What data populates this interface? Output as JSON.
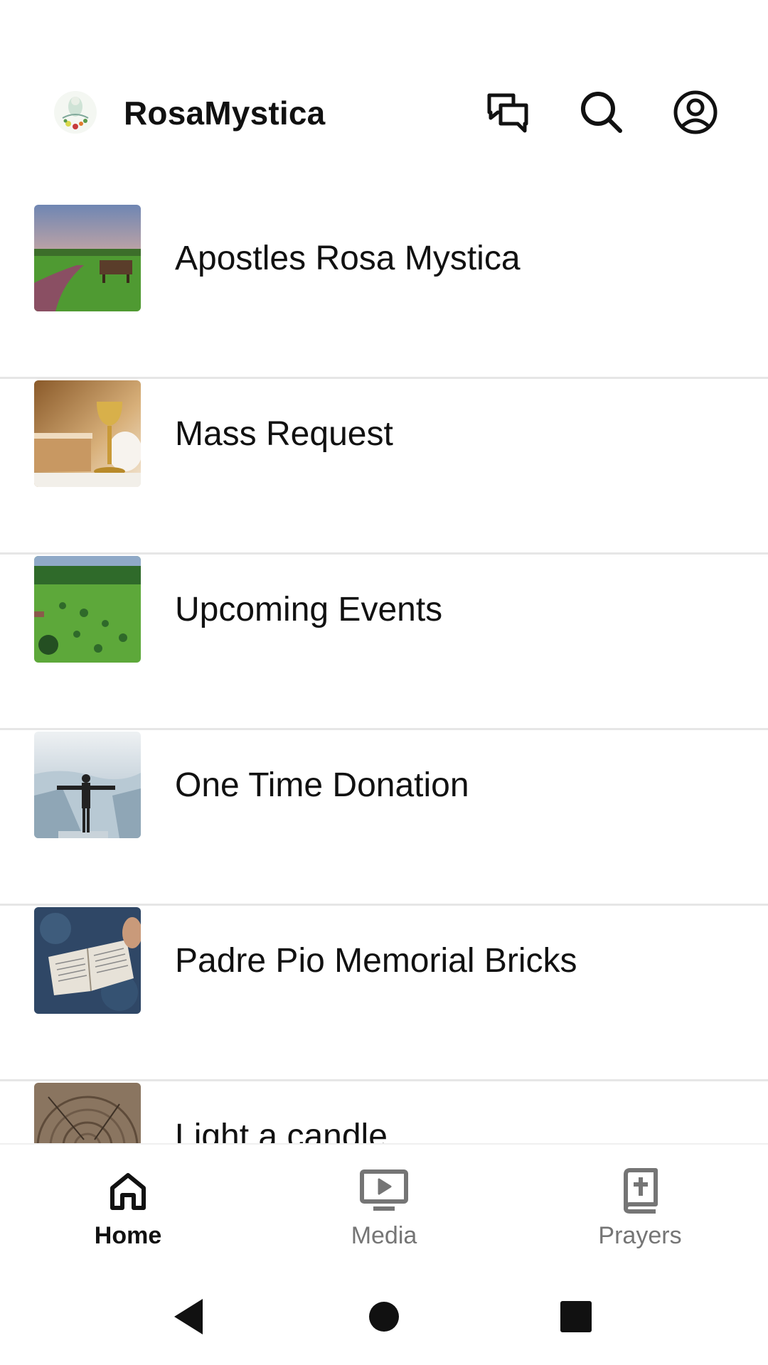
{
  "app": {
    "title": "RosaMystica",
    "logo_icon": "rosa-mystica-logo"
  },
  "header_actions": [
    {
      "name": "chat",
      "icon": "chat-bubbles-icon"
    },
    {
      "name": "search",
      "icon": "search-icon"
    },
    {
      "name": "account",
      "icon": "account-circle-icon"
    }
  ],
  "list": {
    "items": [
      {
        "label": "Apostles Rosa Mystica",
        "image": "garden-path-landscape"
      },
      {
        "label": "Mass Request",
        "image": "chalice-and-book"
      },
      {
        "label": "Upcoming Events",
        "image": "green-valley-aerial"
      },
      {
        "label": "One Time Donation",
        "image": "man-on-cliff"
      },
      {
        "label": "Padre Pio Memorial Bricks",
        "image": "open-bible"
      },
      {
        "label": "Light a candle",
        "image": "wood-texture"
      }
    ]
  },
  "bottom_nav": {
    "items": [
      {
        "label": "Home",
        "icon": "home-icon",
        "active": true
      },
      {
        "label": "Media",
        "icon": "media-tv-icon",
        "active": false
      },
      {
        "label": "Prayers",
        "icon": "prayer-book-icon",
        "active": false
      }
    ]
  },
  "system_nav": [
    "back",
    "home",
    "recents"
  ],
  "colors": {
    "text_primary": "#111111",
    "text_inactive": "#757575",
    "divider": "#e6e6e6",
    "background": "#ffffff"
  }
}
